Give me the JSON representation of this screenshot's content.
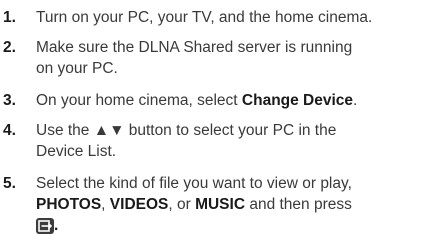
{
  "steps": [
    {
      "number": "1.",
      "text": "Turn on your PC, your TV, and the home cinema."
    },
    {
      "number": "2.",
      "text_line1": "Make sure the DLNA Shared server is running",
      "text_line2": "on your PC."
    },
    {
      "number": "3.",
      "text_before": "On your home cinema, select ",
      "bold": "Change Device",
      "text_after": "."
    },
    {
      "number": "4.",
      "text_line1": "Use the ▲▼ button to select your PC in the",
      "text_line2": "Device List."
    },
    {
      "number": "5.",
      "text_line1": "Select the kind of file you want to view or play,",
      "bold_photos": "PHOTOS",
      "sep1": ", ",
      "bold_videos": "VIDEOS",
      "sep2": ", or ",
      "bold_music": "MUSIC",
      "text_after": " and then press",
      "period": ".",
      "icon": "enter-button-icon"
    }
  ]
}
